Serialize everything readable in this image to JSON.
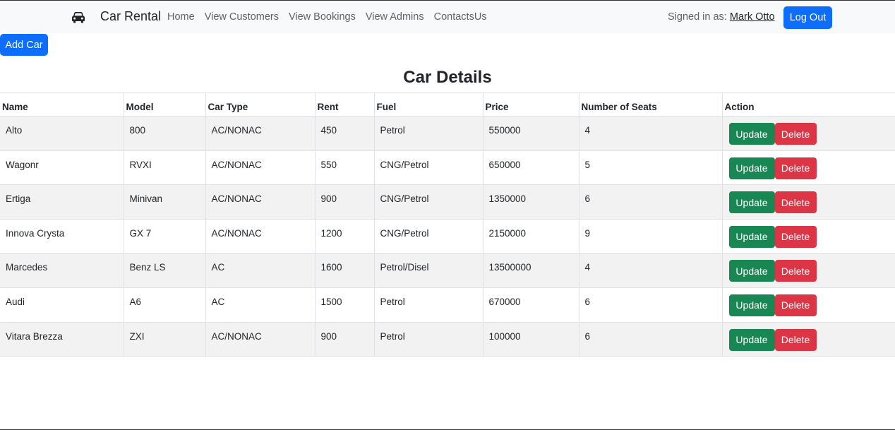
{
  "navbar": {
    "brand_icon": "car-icon",
    "brand": "Car Rental",
    "links": [
      "Home",
      "View Customers",
      "View Bookings",
      "View Admins",
      "ContactsUs"
    ],
    "signed_in_prefix": "Signed in as: ",
    "signed_in_user": "Mark Otto",
    "logout_label": "Log Out"
  },
  "add_car_label": "Add Car",
  "title": "Car Details",
  "table": {
    "columns": [
      "Name",
      "Model",
      "Car Type",
      "Rent",
      "Fuel",
      "Price",
      "Number of Seats",
      "Action"
    ],
    "rows": [
      {
        "name": "Alto",
        "model": "800",
        "type": "AC/NONAC",
        "rent": "450",
        "fuel": "Petrol",
        "price": "550000",
        "seats": "4"
      },
      {
        "name": "Wagonr",
        "model": "RVXI",
        "type": "AC/NONAC",
        "rent": "550",
        "fuel": "CNG/Petrol",
        "price": "650000",
        "seats": "5"
      },
      {
        "name": "Ertiga",
        "model": "Minivan",
        "type": "AC/NONAC",
        "rent": "900",
        "fuel": "CNG/Petrol",
        "price": "1350000",
        "seats": "6"
      },
      {
        "name": "Innova Crysta",
        "model": "GX 7",
        "type": "AC/NONAC",
        "rent": "1200",
        "fuel": "CNG/Petrol",
        "price": "2150000",
        "seats": "9"
      },
      {
        "name": "Marcedes",
        "model": "Benz LS",
        "type": "AC",
        "rent": "1600",
        "fuel": "Petrol/Disel",
        "price": "13500000",
        "seats": "4"
      },
      {
        "name": "Audi",
        "model": "A6",
        "type": "AC",
        "rent": "1500",
        "fuel": "Petrol",
        "price": "670000",
        "seats": "6"
      },
      {
        "name": "Vitara Brezza",
        "model": "ZXI",
        "type": "AC/NONAC",
        "rent": "900",
        "fuel": "Petrol",
        "price": "100000",
        "seats": "6"
      }
    ],
    "update_label": "Update",
    "delete_label": "Delete"
  },
  "colors": {
    "primary": "#0d6efd",
    "success": "#198754",
    "danger": "#dc3545",
    "navbar_bg": "#f8f9fa",
    "stripe": "#f2f2f2"
  }
}
